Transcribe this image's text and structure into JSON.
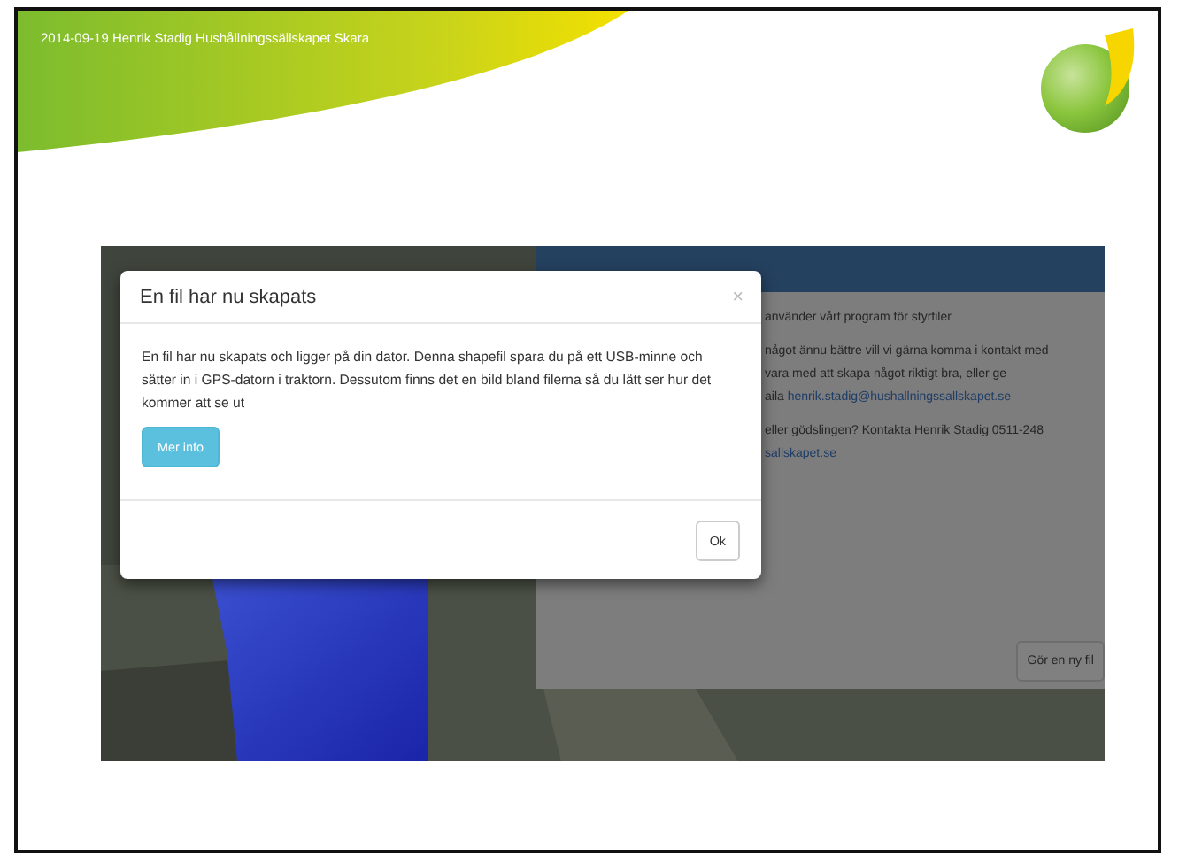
{
  "slide": {
    "header_text": "2014-09-19 Henrik Stadig Hushållningssällskapet Skara"
  },
  "screenshot": {
    "panel": {
      "paragraphs": [
        {
          "lines": [
            {
              "text": "använder vårt program för styrfiler"
            }
          ]
        },
        {
          "lines": [
            {
              "text": "något ännu bättre vill vi gärna komma i kontakt med"
            },
            {
              "text": "vara med att skapa något riktigt bra, eller ge"
            },
            {
              "text": "aila ",
              "link": "henrik.stadig@hushallningssallskapet.se"
            }
          ]
        },
        {
          "lines": [
            {
              "text": "eller gödslingen? Kontakta Henrik Stadig 0511-248"
            },
            {
              "link": "sallskapet.se"
            }
          ]
        }
      ],
      "button": "Gör en ny fil"
    },
    "dialog": {
      "title": "En fil har nu skapats",
      "close": "×",
      "message": "En fil har nu skapats och ligger på din dator. Denna shapefil spara du på ett USB-minne och sätter in i GPS-datorn i traktorn. Dessutom finns det en bild bland filerna så du lätt ser hur det kommer att se ut",
      "buttons": [
        {
          "label": "Mer info",
          "kind": "primary"
        },
        {
          "label": "Ok",
          "kind": "default"
        }
      ]
    }
  }
}
